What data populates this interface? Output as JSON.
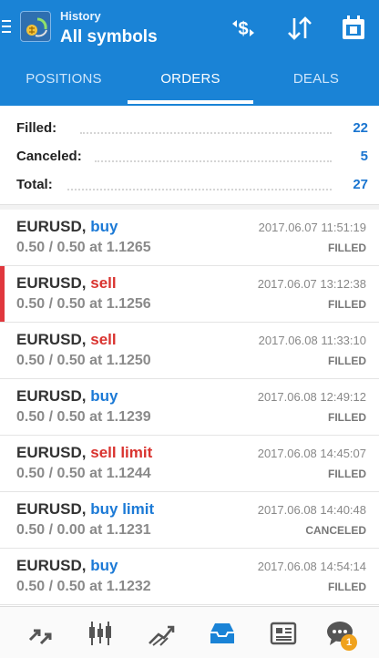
{
  "header": {
    "subtitle": "History",
    "title": "All symbols"
  },
  "tabs": [
    {
      "label": "POSITIONS",
      "active": false
    },
    {
      "label": "ORDERS",
      "active": true
    },
    {
      "label": "DEALS",
      "active": false
    }
  ],
  "summary": {
    "filled_label": "Filled:",
    "filled_value": "22",
    "canceled_label": "Canceled:",
    "canceled_value": "5",
    "total_label": "Total:",
    "total_value": "27"
  },
  "orders": [
    {
      "symbol": "EURUSD,",
      "type": "buy",
      "side": "buy",
      "volume": "0.50 / 0.50 at 1.1265",
      "time": "2017.06.07 11:51:19",
      "status": "FILLED",
      "selected": false
    },
    {
      "symbol": "EURUSD,",
      "type": "sell",
      "side": "sell",
      "volume": "0.50 / 0.50 at 1.1256",
      "time": "2017.06.07 13:12:38",
      "status": "FILLED",
      "selected": true
    },
    {
      "symbol": "EURUSD,",
      "type": "sell",
      "side": "sell",
      "volume": "0.50 / 0.50 at 1.1250",
      "time": "2017.06.08 11:33:10",
      "status": "FILLED",
      "selected": false
    },
    {
      "symbol": "EURUSD,",
      "type": "buy",
      "side": "buy",
      "volume": "0.50 / 0.50 at 1.1239",
      "time": "2017.06.08 12:49:12",
      "status": "FILLED",
      "selected": false
    },
    {
      "symbol": "EURUSD,",
      "type": "sell limit",
      "side": "sell",
      "volume": "0.50 / 0.50 at 1.1244",
      "time": "2017.06.08 14:45:07",
      "status": "FILLED",
      "selected": false
    },
    {
      "symbol": "EURUSD,",
      "type": "buy limit",
      "side": "buy",
      "volume": "0.50 / 0.00 at 1.1231",
      "time": "2017.06.08 14:40:48",
      "status": "CANCELED",
      "selected": false
    },
    {
      "symbol": "EURUSD,",
      "type": "buy",
      "side": "buy",
      "volume": "0.50 / 0.50 at 1.1232",
      "time": "2017.06.08 14:54:14",
      "status": "FILLED",
      "selected": false
    }
  ],
  "bottom_nav": {
    "items": [
      "quotes-icon",
      "chart-icon",
      "trade-icon",
      "history-icon",
      "news-icon",
      "chat-icon"
    ],
    "active": "history-icon",
    "chat_badge": "1"
  },
  "colors": {
    "accent": "#1a83d6",
    "buy": "#1c7ad6",
    "sell": "#d9332f",
    "badge": "#f0a21d"
  }
}
